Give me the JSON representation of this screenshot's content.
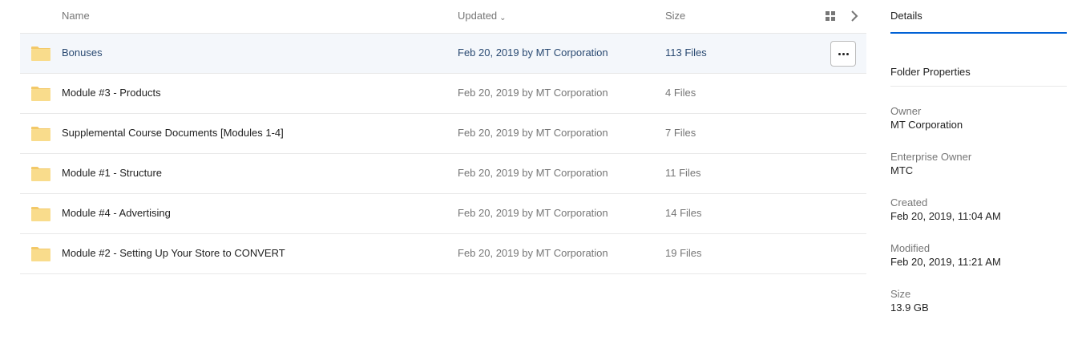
{
  "columns": {
    "name": "Name",
    "updated": "Updated",
    "updated_sort_glyph": "⌄",
    "size": "Size"
  },
  "icons": {
    "view": "grid-view-icon",
    "panel": "chevron-right-icon",
    "folder": "folder-icon",
    "more": "more-options-icon"
  },
  "colors": {
    "folder_fill": "#f9dc8c",
    "folder_tab": "#f3c969",
    "accent": "#0061d5",
    "selected_row_bg": "#f4f7fb"
  },
  "rows": [
    {
      "name": "Bonuses",
      "updated": "Feb 20, 2019 by MT Corporation",
      "size": "113 Files",
      "selected": true
    },
    {
      "name": "Module #3 - Products",
      "updated": "Feb 20, 2019 by MT Corporation",
      "size": "4 Files",
      "selected": false
    },
    {
      "name": "Supplemental Course Documents [Modules 1-4]",
      "updated": "Feb 20, 2019 by MT Corporation",
      "size": "7 Files",
      "selected": false
    },
    {
      "name": "Module #1 - Structure",
      "updated": "Feb 20, 2019 by MT Corporation",
      "size": "11 Files",
      "selected": false
    },
    {
      "name": "Module #4 - Advertising",
      "updated": "Feb 20, 2019 by MT Corporation",
      "size": "14 Files",
      "selected": false
    },
    {
      "name": "Module #2 - Setting Up Your Store to CONVERT",
      "updated": "Feb 20, 2019 by MT Corporation",
      "size": "19 Files",
      "selected": false
    }
  ],
  "details": {
    "tab": "Details",
    "section_title": "Folder Properties",
    "properties": [
      {
        "label": "Owner",
        "value": "MT Corporation"
      },
      {
        "label": "Enterprise Owner",
        "value": "MTC"
      },
      {
        "label": "Created",
        "value": "Feb 20, 2019, 11:04 AM"
      },
      {
        "label": "Modified",
        "value": "Feb 20, 2019, 11:21 AM"
      },
      {
        "label": "Size",
        "value": "13.9 GB"
      }
    ]
  }
}
